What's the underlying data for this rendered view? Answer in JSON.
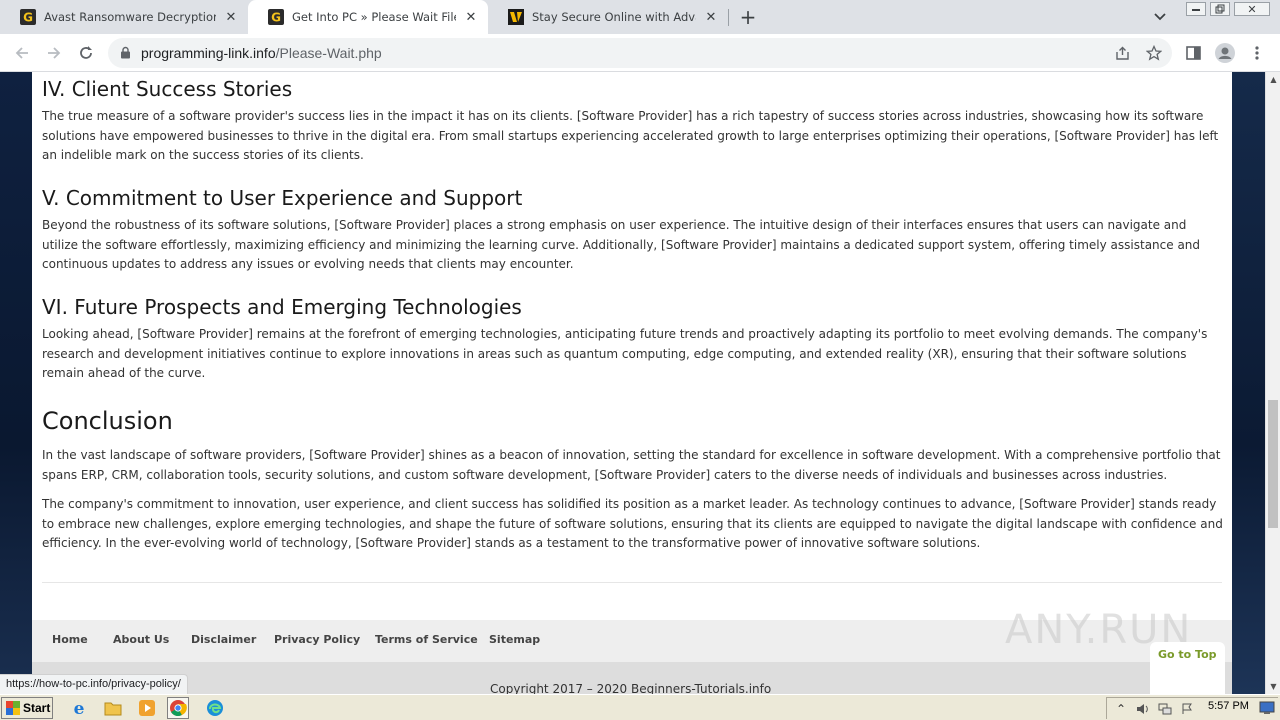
{
  "browser": {
    "tabs": [
      {
        "title": "Avast Ransomware Decryption Tools",
        "favicon": "g-icon",
        "active": false
      },
      {
        "title": "Get Into PC » Please Wait File Will St",
        "favicon": "g-icon",
        "active": true
      },
      {
        "title": "Stay Secure Online with Advanced A",
        "favicon": "norton-icon",
        "active": false
      }
    ],
    "url_domain": "programming-link.info",
    "url_path": "/Please-Wait.php",
    "status_url": "https://how-to-pc.info/privacy-policy/"
  },
  "article": {
    "sections": [
      {
        "heading": "IV. Client Success Stories",
        "body": "The true measure of a software provider's success lies in the impact it has on its clients. [Software Provider] has a rich tapestry of success stories across industries, showcasing how its software solutions have empowered businesses to thrive in the digital era. From small startups experiencing accelerated growth to large enterprises optimizing their operations, [Software Provider] has left an indelible mark on the success stories of its clients."
      },
      {
        "heading": "V. Commitment to User Experience and Support",
        "body": "Beyond the robustness of its software solutions, [Software Provider] places a strong emphasis on user experience. The intuitive design of their interfaces ensures that users can navigate and utilize the software effortlessly, maximizing efficiency and minimizing the learning curve. Additionally, [Software Provider] maintains a dedicated support system, offering timely assistance and continuous updates to address any issues or evolving needs that clients may encounter."
      },
      {
        "heading": "VI. Future Prospects and Emerging Technologies",
        "body": "Looking ahead, [Software Provider] remains at the forefront of emerging technologies, anticipating future trends and proactively adapting its portfolio to meet evolving demands. The company's research and development initiatives continue to explore innovations in areas such as quantum computing, edge computing, and extended reality (XR), ensuring that their software solutions remain ahead of the curve."
      }
    ],
    "conclusion_heading": "Conclusion",
    "conclusion_p1": "In the vast landscape of software providers, [Software Provider] shines as a beacon of innovation, setting the standard for excellence in software development. With a comprehensive portfolio that spans ERP, CRM, collaboration tools, security solutions, and custom software development, [Software Provider] caters to the diverse needs of individuals and businesses across industries.",
    "conclusion_p2": "The company's commitment to innovation, user experience, and client success has solidified its position as a market leader. As technology continues to advance, [Software Provider] stands ready to embrace new challenges, explore emerging technologies, and shape the future of software solutions, ensuring that its clients are equipped to navigate the digital landscape with confidence and efficiency. In the ever-evolving world of technology, [Software Provider] stands as a testament to the transformative power of innovative software solutions."
  },
  "footer": {
    "links": [
      "Home",
      "About Us",
      "Disclaimer",
      "Privacy Policy",
      "Terms of Service",
      "Sitemap"
    ],
    "copyright": "Copyright 2017 – 2020 Beginners-Tutorials.info",
    "go_to_top": "Go to Top"
  },
  "watermark": "ANY.RUN",
  "taskbar": {
    "start_label": "Start",
    "clock": "5:57 PM"
  },
  "colors": {
    "page_bg": "#0f2140",
    "footer_nav_bg": "#eeeeee",
    "go_to_top": "#7a9a2a"
  }
}
